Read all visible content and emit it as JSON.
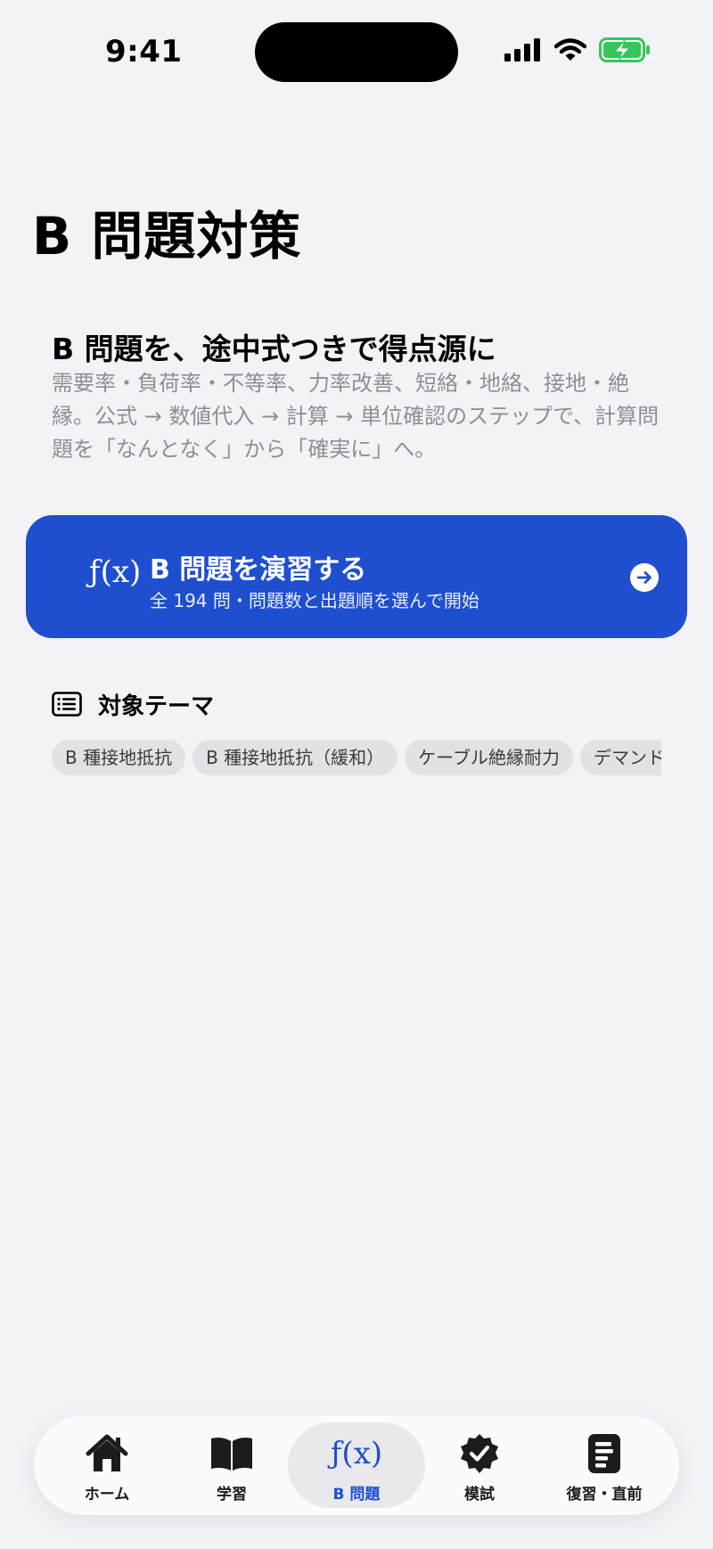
{
  "status_bar": {
    "time": "9:41"
  },
  "page": {
    "title": "B 問題対策"
  },
  "intro": {
    "heading": "B 問題を、途中式つきで得点源に",
    "body": "需要率・負荷率・不等率、力率改善、短絡・地絡、接地・絶縁。公式 → 数値代入 → 計算 → 単位確認のステップで、計算問題を「なんとなく」から「確実に」へ。"
  },
  "practice_card": {
    "icon_text": "ƒ(x)",
    "title": "B 問題を演習する",
    "subtitle": "全 194 問・問題数と出題順を選んで開始",
    "accent": "#1f4fcf"
  },
  "themes": {
    "label": "対象テーマ",
    "chips": [
      "B 種接地抵抗",
      "B 種接地抵抗（緩和）",
      "ケーブル絶縁耐力",
      "デマンド"
    ]
  },
  "tab_bar": {
    "tabs": [
      {
        "label": "ホーム",
        "icon": "house-icon"
      },
      {
        "label": "学習",
        "icon": "book-icon"
      },
      {
        "label": "B 問題",
        "icon": "function-icon",
        "icon_text": "ƒ(x)",
        "active": true
      },
      {
        "label": "模試",
        "icon": "checkmark-seal-icon"
      },
      {
        "label": "復習・直前",
        "icon": "document-icon"
      }
    ],
    "active_color": "#1f4fcf"
  }
}
